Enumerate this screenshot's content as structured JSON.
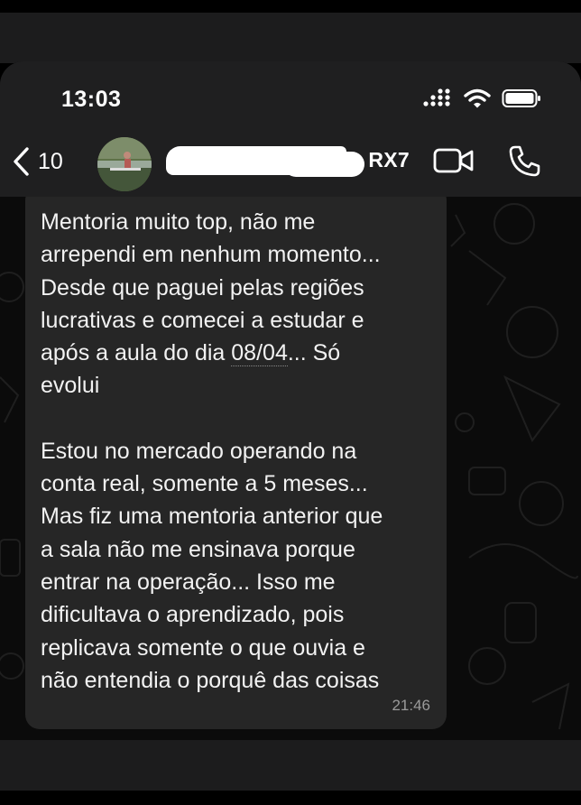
{
  "status_bar": {
    "time": "13:03",
    "icons": [
      "signal-icon",
      "wifi-icon",
      "battery-icon"
    ]
  },
  "header": {
    "back_count": "10",
    "contact_name_visible": "RX7",
    "icons": [
      "chevron-left-icon",
      "video-call-icon",
      "phone-icon"
    ]
  },
  "message": {
    "paragraph1_pre": "Mentoria muito top, não me\narrependi em nenhum momento...\nDesde que paguei pelas regiões\nlucrativas e comecei a estudar e\napós a aula do dia ",
    "date_ref": "08/04",
    "paragraph1_post": "... Só\nevolui",
    "paragraph2": "Estou no mercado operando na\nconta real, somente a 5 meses...\nMas fiz uma mentoria anterior que\na sala não me ensinava porque\nentrar na operação... Isso me\ndificultava o aprendizado, pois\nreplicava somente o que ouvia e\nnão entendia o porquê das coisas",
    "time": "21:46"
  },
  "colors": {
    "bubble": "#262626",
    "header": "#1f1f20",
    "chat_background": "#0b0b0b",
    "text": "#f2f2f2",
    "timestamp": "#9a9a9a"
  }
}
